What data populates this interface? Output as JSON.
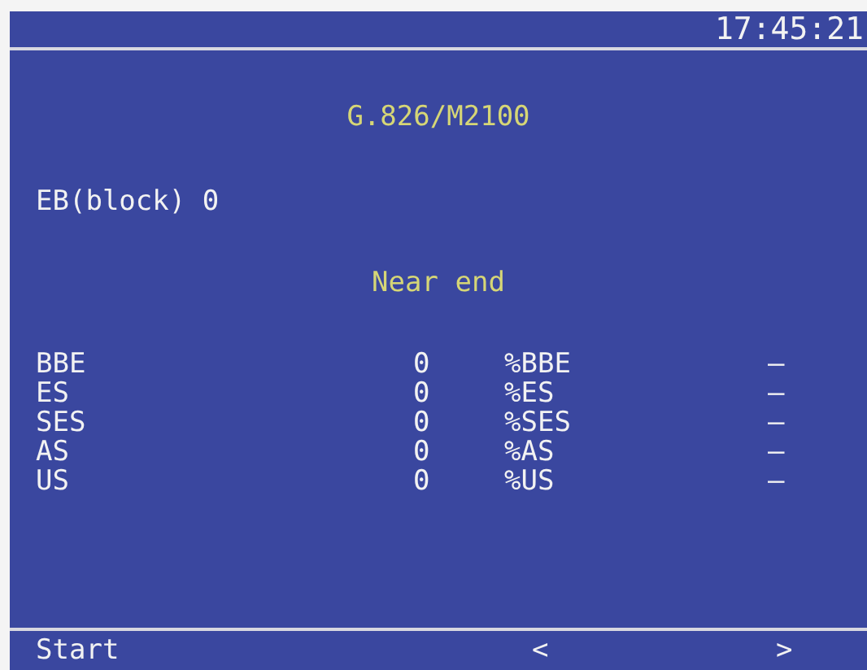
{
  "clock": "17:45:21",
  "title": "G.826/M2100",
  "eb_block": {
    "label": "EB(block)",
    "value": "0"
  },
  "section": "Near end",
  "rows": [
    {
      "name": "BBE",
      "value": "0",
      "percent_label": "%BBE",
      "percent": "–"
    },
    {
      "name": "ES",
      "value": "0",
      "percent_label": "%ES",
      "percent": "–"
    },
    {
      "name": "SES",
      "value": "0",
      "percent_label": "%SES",
      "percent": "–"
    },
    {
      "name": "AS",
      "value": "0",
      "percent_label": "%AS",
      "percent": "–"
    },
    {
      "name": "US",
      "value": "0",
      "percent_label": "%US",
      "percent": "–"
    }
  ],
  "softkeys": [
    "Start",
    "<",
    ">"
  ]
}
